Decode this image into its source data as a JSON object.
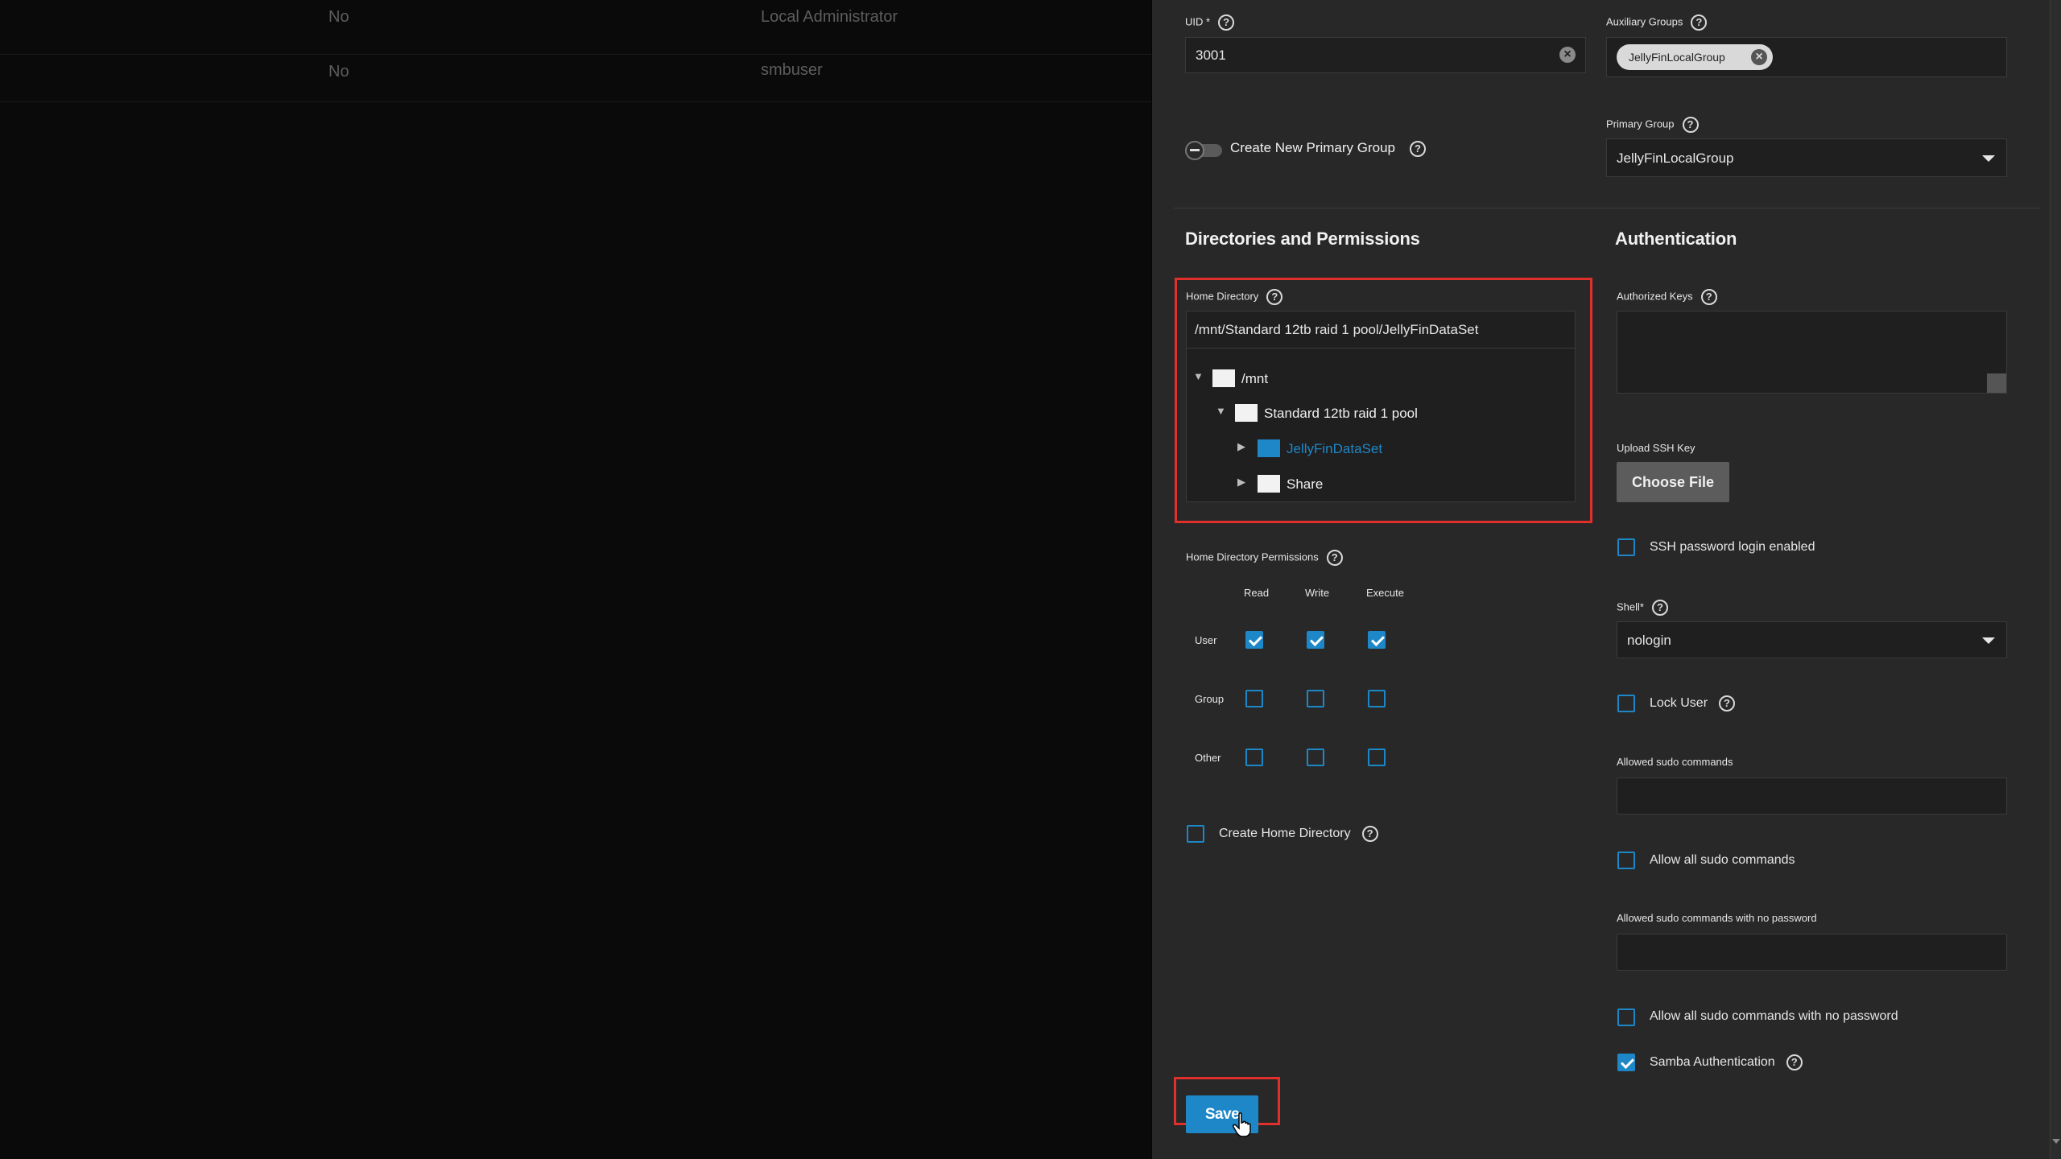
{
  "background_table": {
    "rows": [
      {
        "builtin": "No",
        "full_name": "Local Administrator"
      },
      {
        "builtin": "No",
        "full_name": "smbuser"
      }
    ]
  },
  "uid": {
    "label": "UID",
    "required_mark": "*",
    "value": "3001"
  },
  "auxiliary_groups": {
    "label": "Auxiliary Groups",
    "chips": [
      "JellyFinLocalGroup"
    ]
  },
  "primary_group": {
    "label": "Primary Group",
    "value": "JellyFinLocalGroup"
  },
  "create_primary_group": {
    "label": "Create New Primary Group",
    "enabled": false
  },
  "directories": {
    "heading": "Directories and Permissions",
    "home_directory": {
      "label": "Home Directory",
      "path": "/mnt/Standard 12tb raid 1 pool/JellyFinDataSet",
      "tree": [
        {
          "name": "/mnt",
          "expanded": true,
          "selected": false
        },
        {
          "name": "Standard 12tb raid 1 pool",
          "expanded": true,
          "selected": false
        },
        {
          "name": "JellyFinDataSet",
          "expanded": false,
          "selected": true
        },
        {
          "name": "Share",
          "expanded": false,
          "selected": false
        }
      ]
    },
    "permissions": {
      "label": "Home Directory Permissions",
      "columns": [
        "Read",
        "Write",
        "Execute"
      ],
      "rows": [
        {
          "name": "User",
          "values": [
            true,
            true,
            true
          ]
        },
        {
          "name": "Group",
          "values": [
            false,
            false,
            false
          ]
        },
        {
          "name": "Other",
          "values": [
            false,
            false,
            false
          ]
        }
      ]
    },
    "create_home_directory": {
      "label": "Create Home Directory",
      "checked": false
    }
  },
  "authentication": {
    "heading": "Authentication",
    "authorized_keys": {
      "label": "Authorized Keys",
      "value": ""
    },
    "upload_ssh_key": {
      "label": "Upload SSH Key",
      "button": "Choose File"
    },
    "ssh_password_login": {
      "label": "SSH password login enabled",
      "checked": false
    },
    "shell": {
      "label": "Shell",
      "required_mark": "*",
      "value": "nologin"
    },
    "lock_user": {
      "label": "Lock User",
      "checked": false
    },
    "allowed_sudo_commands": {
      "label": "Allowed sudo commands",
      "value": ""
    },
    "allow_all_sudo": {
      "label": "Allow all sudo commands",
      "checked": false
    },
    "allowed_sudo_nopasswd": {
      "label": "Allowed sudo commands with no password",
      "value": ""
    },
    "allow_all_sudo_nopasswd": {
      "label": "Allow all sudo commands with no password",
      "checked": false
    },
    "samba_auth": {
      "label": "Samba Authentication",
      "checked": true
    }
  },
  "save_button": "Save",
  "colors": {
    "accent": "#1e87c8",
    "highlight_box": "#e0302c",
    "panel": "#282828"
  },
  "icons": {
    "help": "?",
    "clear": "×"
  }
}
